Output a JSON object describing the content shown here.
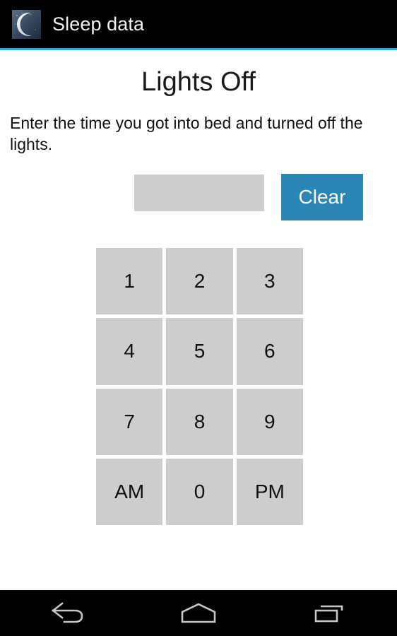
{
  "window": {
    "app_title": "Sleep data",
    "app_icon": "crescent-moon-icon",
    "accent_color": "#35a7d0",
    "titlebar_color": "#000000"
  },
  "screen": {
    "page_title": "Lights Off",
    "instructions": "Enter the time you got into bed and turned off the lights."
  },
  "entry": {
    "time_value": "",
    "time_placeholder": "",
    "clear_label": "Clear",
    "clear_color": "#2b86b5",
    "field_color": "#cdcdcd"
  },
  "keypad": {
    "key_color": "#cdcdcd",
    "keys": [
      {
        "label": "1",
        "name": "key-1"
      },
      {
        "label": "2",
        "name": "key-2"
      },
      {
        "label": "3",
        "name": "key-3"
      },
      {
        "label": "4",
        "name": "key-4"
      },
      {
        "label": "5",
        "name": "key-5"
      },
      {
        "label": "6",
        "name": "key-6"
      },
      {
        "label": "7",
        "name": "key-7"
      },
      {
        "label": "8",
        "name": "key-8"
      },
      {
        "label": "9",
        "name": "key-9"
      },
      {
        "label": "AM",
        "name": "key-am"
      },
      {
        "label": "0",
        "name": "key-0"
      },
      {
        "label": "PM",
        "name": "key-pm"
      }
    ]
  },
  "navbar": {
    "back_icon": "back-arrow-icon",
    "home_icon": "home-icon",
    "recents_icon": "recent-apps-icon"
  }
}
